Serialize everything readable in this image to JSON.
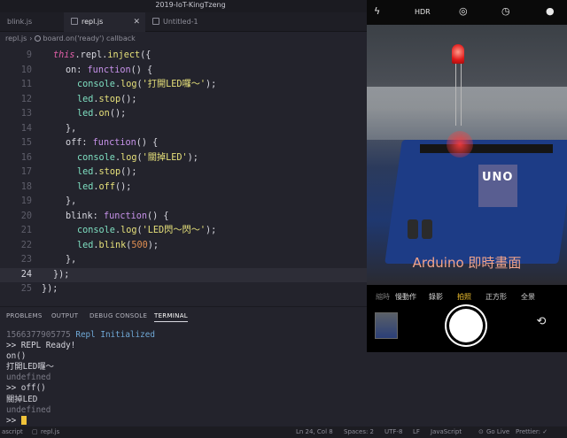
{
  "window": {
    "title": "2019-IoT-KingTzeng"
  },
  "tabs": [
    {
      "label": "blink.js"
    },
    {
      "label": "repl.js"
    },
    {
      "label": "Untitled-1"
    }
  ],
  "breadcrumb": {
    "file": "repl.js",
    "symbol": "board.on('ready') callback"
  },
  "editor": {
    "current_line": 24,
    "lines": [
      {
        "n": "9",
        "text": "this.repl.inject({"
      },
      {
        "n": "10",
        "text": "on: function() {"
      },
      {
        "n": "11",
        "text": "console.log('打開LED囉～');"
      },
      {
        "n": "12",
        "text": "led.stop();"
      },
      {
        "n": "13",
        "text": "led.on();"
      },
      {
        "n": "14",
        "text": "},"
      },
      {
        "n": "15",
        "text": "off: function() {"
      },
      {
        "n": "16",
        "text": "console.log('關掉LED');"
      },
      {
        "n": "17",
        "text": "led.stop();"
      },
      {
        "n": "18",
        "text": "led.off();"
      },
      {
        "n": "19",
        "text": "},"
      },
      {
        "n": "20",
        "text": "blink: function() {"
      },
      {
        "n": "21",
        "text": "console.log('LED閃～閃～');"
      },
      {
        "n": "22",
        "text": "led.blink(500);"
      },
      {
        "n": "23",
        "text": "},"
      },
      {
        "n": "24",
        "text": "});"
      },
      {
        "n": "25",
        "text": "});"
      }
    ]
  },
  "phone": {
    "caption": "Arduino 即時畫面",
    "board_label": "UNO",
    "top_icons": [
      "flash-off-icon",
      "hdr-icon",
      "live-photo-icon",
      "timer-icon",
      "filter-icon"
    ],
    "hdr_label": "HDR",
    "modes": [
      "縮時",
      "慢動作",
      "錄影",
      "拍照",
      "正方形",
      "全景"
    ],
    "active_mode": "拍照"
  },
  "panel": {
    "tabs": [
      "PROBLEMS",
      "OUTPUT",
      "DEBUG CONSOLE",
      "TERMINAL"
    ],
    "active_tab": "TERMINAL"
  },
  "terminal": {
    "lines": [
      {
        "ts": "1566377905775",
        "text": " Repl Initialized"
      },
      {
        "text": ">> REPL Ready!"
      },
      {
        "text": "on()"
      },
      {
        "text": "打開LED囉～"
      },
      {
        "text": "undefined",
        "dim": true
      },
      {
        "text": ">> off()"
      },
      {
        "text": "關掉LED"
      },
      {
        "text": "undefined",
        "dim": true
      },
      {
        "text": ">> "
      }
    ]
  },
  "statusbar": {
    "left": "ascript",
    "file": "repl.js",
    "position": "Ln 24, Col 8",
    "spaces": "Spaces: 2",
    "encoding": "UTF-8",
    "eol": "LF",
    "language": "JavaScript",
    "golive": "Go Live",
    "prettier": "Prettier: ✓"
  }
}
